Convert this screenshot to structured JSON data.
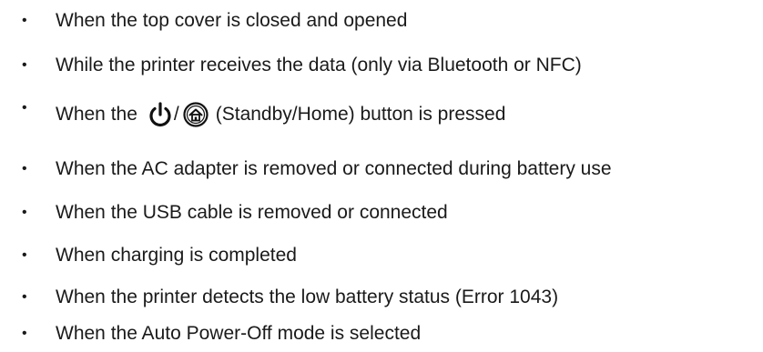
{
  "bullet_char": "•",
  "items": [
    {
      "text": "When the top cover is closed and opened"
    },
    {
      "text": "While the printer receives the data (only via Bluetooth or NFC)"
    },
    {
      "text_before": "When the",
      "separator": "/",
      "text_after": "(Standby/Home) button is pressed",
      "icons": [
        "power-icon",
        "home-icon"
      ]
    },
    {
      "text": "When the AC adapter is removed or connected during battery use"
    },
    {
      "text": "When the USB cable is removed or connected"
    },
    {
      "text": "When charging is completed"
    },
    {
      "text": "When the printer detects the low battery status (Error 1043)"
    },
    {
      "text": "When the Auto Power-Off mode is selected"
    }
  ]
}
